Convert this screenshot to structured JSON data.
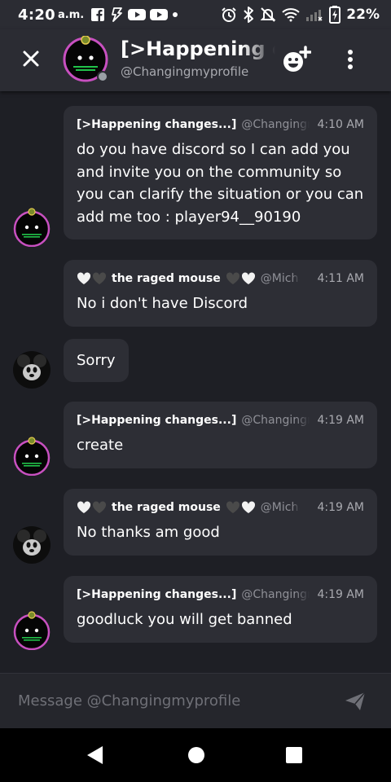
{
  "status_bar": {
    "time": "4:20",
    "ampm": "a.m.",
    "battery": "22%",
    "icons": [
      "facebook-icon",
      "bolt-icon",
      "youtube-icon",
      "youtube-icon",
      "dot-icon",
      "alarm-icon",
      "bluetooth-icon",
      "mute-icon",
      "wifi-icon",
      "signal-icon",
      "battery-icon"
    ]
  },
  "header": {
    "title": "[>Happening c",
    "handle": "@Changingmyprofile"
  },
  "messages": [
    {
      "author": "[>Happening changes...]",
      "handle": "@Changingmyprofile",
      "time": "4:10 AM",
      "text": "do you have discord so I can add you and invite you on the community so you can clarify the situation or you can add me too : player94__90190",
      "sender": "happening"
    },
    {
      "author": "the raged mouse",
      "handle": "@Michael",
      "time": "4:11 AM",
      "text": "No i don't have Discord",
      "sender": "mouse"
    },
    {
      "text": "Sorry",
      "sender": "mouse"
    },
    {
      "author": "[>Happening changes...]",
      "handle": "@Changingmyprofile",
      "time": "4:19 AM",
      "text": "create",
      "sender": "happening"
    },
    {
      "author": "the raged mouse",
      "handle": "@Michael",
      "time": "4:19 AM",
      "text": "No thanks am good",
      "sender": "mouse"
    },
    {
      "author": "[>Happening changes...]",
      "handle": "@Changingmyprofile",
      "time": "4:19 AM",
      "text": "goodluck you will get banned",
      "sender": "happening"
    }
  ],
  "input": {
    "placeholder": "Message @Changingmyprofile"
  },
  "colors": {
    "background": "#1e1f25",
    "bubble": "#2d2e35",
    "header": "#2b2c33",
    "avatar_ring": "#c850c0",
    "online_dot": "#9aa0a6"
  }
}
